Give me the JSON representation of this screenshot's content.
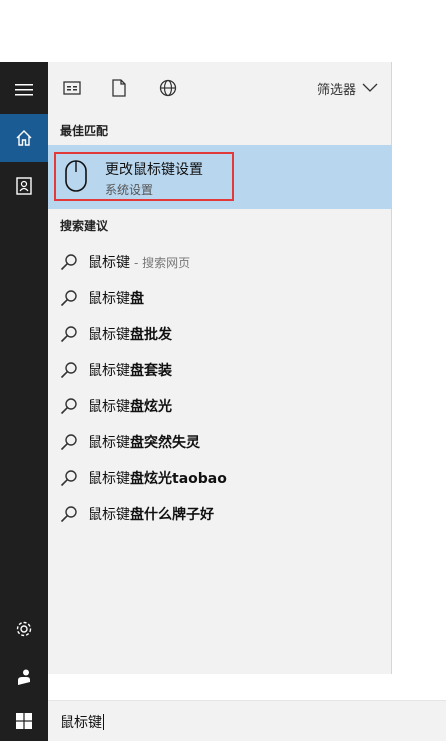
{
  "rail": {
    "items": [
      {
        "name": "hamburger-menu-icon"
      },
      {
        "name": "home-icon"
      },
      {
        "name": "notebook-icon"
      },
      {
        "name": "settings-gear-icon"
      },
      {
        "name": "feedback-person-icon"
      }
    ]
  },
  "toolbar": {
    "filter_label": "筛选器"
  },
  "best_match": {
    "section_title": "最佳匹配",
    "name": "更改鼠标键设置",
    "category": "系统设置"
  },
  "suggestions": {
    "section_title": "搜索建议",
    "items": [
      {
        "prefix": "鼠标键",
        "bold": "",
        "hint": "- 搜索网页"
      },
      {
        "prefix": "鼠标键",
        "bold": "盘",
        "hint": ""
      },
      {
        "prefix": "鼠标键",
        "bold": "盘批发",
        "hint": ""
      },
      {
        "prefix": "鼠标键",
        "bold": "盘套装",
        "hint": ""
      },
      {
        "prefix": "鼠标键",
        "bold": "盘炫光",
        "hint": ""
      },
      {
        "prefix": "鼠标键",
        "bold": "盘突然失灵",
        "hint": ""
      },
      {
        "prefix": "鼠标键",
        "bold": "盘炫光taobao",
        "hint": ""
      },
      {
        "prefix": "鼠标键",
        "bold": "盘什么牌子好",
        "hint": ""
      }
    ]
  },
  "search": {
    "query": "鼠标键"
  },
  "colors": {
    "rail_bg": "#1f1f1f",
    "accent_blue": "#1a5b93",
    "selected_bg": "#b8d6ee",
    "highlight_outline": "#e23a3a"
  }
}
